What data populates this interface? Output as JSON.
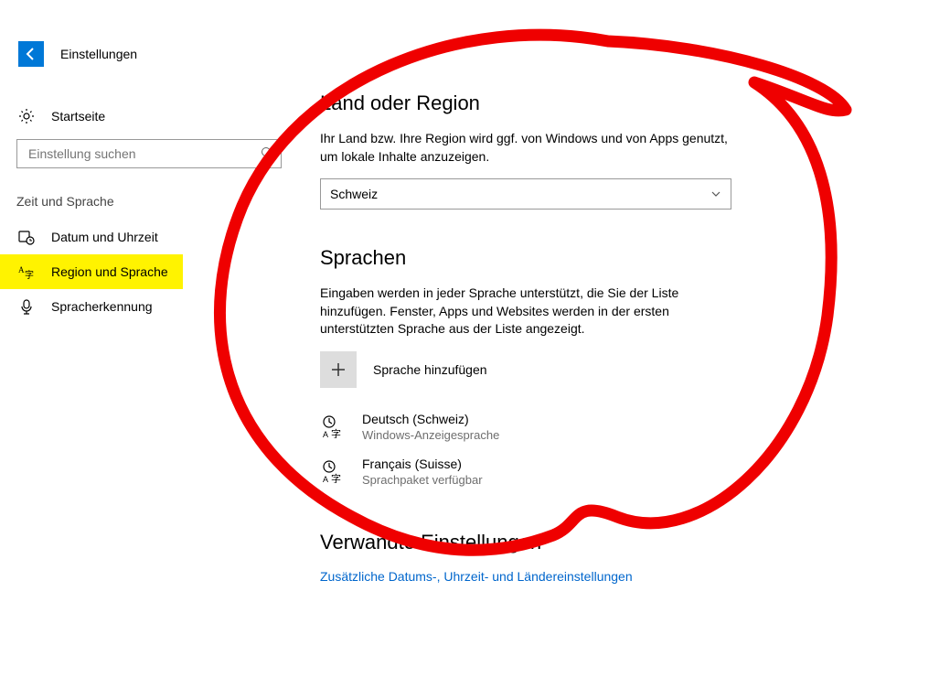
{
  "header": {
    "back_label": "Einstellungen"
  },
  "sidebar": {
    "home_label": "Startseite",
    "search_placeholder": "Einstellung suchen",
    "category_label": "Zeit und Sprache",
    "items": [
      {
        "label": "Datum und Uhrzeit"
      },
      {
        "label": "Region und Sprache"
      },
      {
        "label": "Spracherkennung"
      }
    ]
  },
  "main": {
    "region": {
      "heading": "Land oder Region",
      "desc": "Ihr Land bzw. Ihre Region wird ggf. von Windows und von Apps genutzt, um lokale Inhalte anzuzeigen.",
      "selected": "Schweiz"
    },
    "languages": {
      "heading": "Sprachen",
      "desc": "Eingaben werden in jeder Sprache unterstützt, die Sie der Liste hinzufügen. Fenster, Apps und Websites werden in der ersten unterstützten Sprache aus der Liste angezeigt.",
      "add_label": "Sprache hinzufügen",
      "items": [
        {
          "name": "Deutsch (Schweiz)",
          "sub": "Windows-Anzeigesprache"
        },
        {
          "name": "Français (Suisse)",
          "sub": "Sprachpaket verfügbar"
        }
      ]
    },
    "related": {
      "heading": "Verwandte Einstellungen",
      "link": "Zusätzliche Datums-, Uhrzeit- und Ländereinstellungen"
    }
  }
}
